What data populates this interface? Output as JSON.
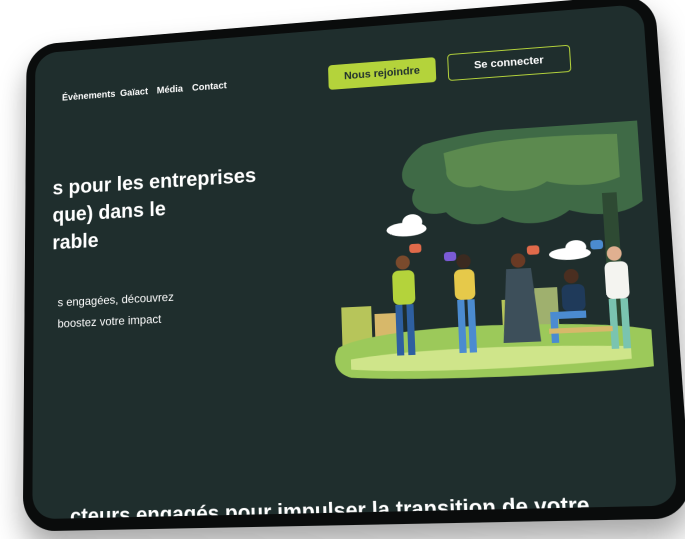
{
  "nav": {
    "items": [
      "Évènements",
      "Gaïact",
      "Média",
      "Contact"
    ],
    "join_label": "Nous rejoindre",
    "connect_label": "Se connecter"
  },
  "hero": {
    "title_lines": [
      "s pour les entreprises",
      "que) dans le",
      "rable"
    ],
    "text_lines": [
      "s engagées, découvrez",
      "boostez votre impact"
    ]
  },
  "section": {
    "heading": "cteurs engagés pour impulser la transition de votre"
  },
  "colors": {
    "background": "#1f2e2d",
    "accent": "#b4d33b",
    "frame": "#0a0c0c"
  }
}
